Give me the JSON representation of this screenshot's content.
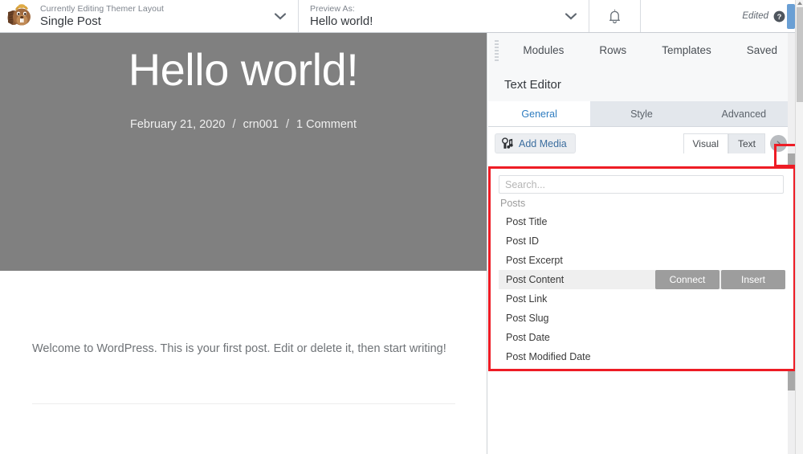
{
  "topbar": {
    "layout": {
      "label": "Currently Editing Themer Layout",
      "value": "Single Post"
    },
    "preview": {
      "label": "Preview As:",
      "value": "Hello world!"
    },
    "notifications_icon": "bell-icon",
    "status": "Edited",
    "help_icon": "question-circle-icon"
  },
  "preview_page": {
    "title": "Hello world!",
    "date": "February 21, 2020",
    "author": "crn001",
    "comments": "1 Comment",
    "separator": "/",
    "body": "Welcome to WordPress. This is your first post. Edit or delete it, then start writing!"
  },
  "panel": {
    "nav": [
      "Modules",
      "Rows",
      "Templates",
      "Saved"
    ],
    "module_title": "Text Editor",
    "tabs": [
      {
        "label": "General",
        "active": true
      },
      {
        "label": "Style",
        "active": false
      },
      {
        "label": "Advanced",
        "active": false
      }
    ],
    "editor_bar": {
      "add_media": "Add Media",
      "visual": "Visual",
      "text": "Text",
      "shortcode_icon": "connect-field-icon"
    }
  },
  "dropdown": {
    "search_placeholder": "Search...",
    "group_label": "Posts",
    "items": [
      {
        "label": "Post Title",
        "hover": false
      },
      {
        "label": "Post ID",
        "hover": false
      },
      {
        "label": "Post Excerpt",
        "hover": false
      },
      {
        "label": "Post Content",
        "hover": true
      },
      {
        "label": "Post Link",
        "hover": false
      },
      {
        "label": "Post Slug",
        "hover": false
      },
      {
        "label": "Post Date",
        "hover": false
      },
      {
        "label": "Post Modified Date",
        "hover": false
      }
    ],
    "actions": {
      "connect": "Connect",
      "insert": "Insert"
    }
  },
  "colors": {
    "highlight": "#ee1c25",
    "accent_blue": "#2e7cc0",
    "hero_bg": "#808080",
    "publish": "#6a9fd4"
  }
}
